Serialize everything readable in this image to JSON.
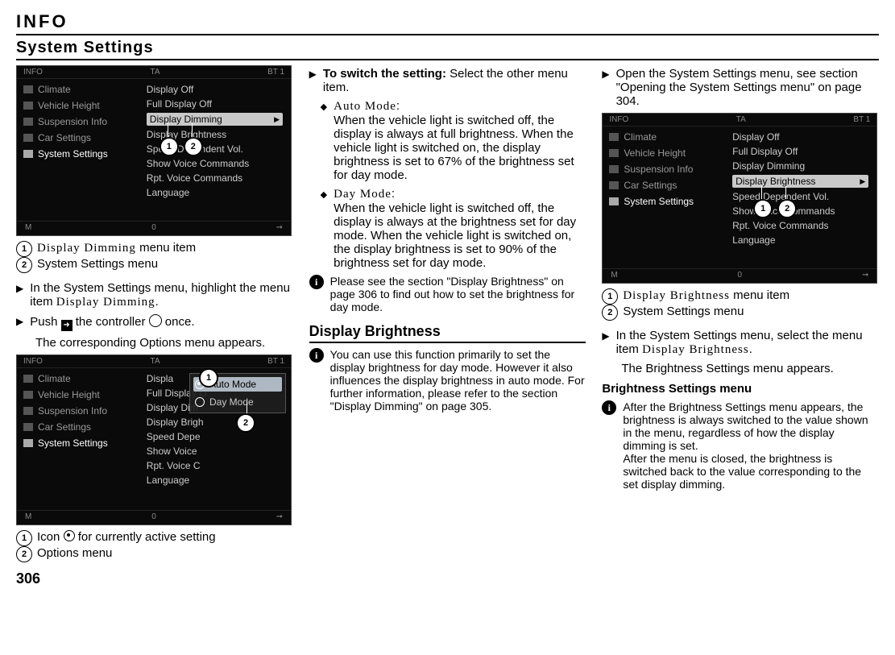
{
  "header": {
    "info": "INFO",
    "section": "System Settings"
  },
  "pageNumber": "306",
  "screenshot_common": {
    "top_left": "INFO",
    "top_mid": "TA",
    "top_right": "BT 1",
    "bottom_left": "M",
    "bottom_mid": "0",
    "bottom_right": "➞",
    "nav": {
      "climate": "Climate",
      "vehicleHeight": "Vehicle Height",
      "suspension": "Suspension Info",
      "carSettings": "Car Settings",
      "systemSettings": "System Settings"
    },
    "menu": {
      "displayOff": "Display Off",
      "fullDisplayOff": "Full Display Off",
      "displayDimming": "Display Dimming",
      "displayBrightness": "Display Brightness",
      "speedVol": "Speed Dependent Vol.",
      "showVoice": "Show Voice Commands",
      "rptVoice": "Rpt. Voice Commands",
      "language": "Language"
    }
  },
  "scrA_caption": {
    "l1_item": "Display Dimming",
    "l1_tail": " menu item",
    "l2": "System Settings menu"
  },
  "scrA_steps": {
    "s1a": "In the System Settings menu, highlight the menu item ",
    "s1b": "Display Dimming",
    "s1c": ".",
    "s2a": "Push ",
    "s2b": " the controller ",
    "s2c": " once.",
    "s2_follow": "The corresponding Options menu appears."
  },
  "popup": {
    "auto": "Auto Mode",
    "day": "Day Mode"
  },
  "scrB_menu_cut": {
    "displayOff": "Displa",
    "fullDisplayOff": "Full Display O",
    "displayDimming": "Display Dim",
    "displayBrightness": "Display Brigh",
    "speedVol": "Speed Depe",
    "showVoice": "Show Voice",
    "rptVoice": "Rpt. Voice C",
    "language": "Language"
  },
  "scrB_caption": {
    "l1": "Icon ",
    "l1_tail": " for currently active setting",
    "l2": "Options menu"
  },
  "col2": {
    "step1_lead": "To switch the setting:",
    "step1_rest": " Select the other menu item.",
    "auto_label": "Auto Mode",
    "auto_text": "When the vehicle light is switched off, the display is always at full brightness. When the vehicle light is switched on, the display brightness is set to 67% of the brightness set for day mode.",
    "day_label": "Day Mode",
    "day_text": "When the vehicle light is switched off, the display is always at the brightness set for day mode. When the vehicle light is switched on, the display brightness is set to 90% of the brightness set for day mode.",
    "note1": "Please see the section \"Display Brightness\" on page 306 to find out how to set the brightness for day mode.",
    "subhead": "Display Brightness",
    "note2": "You can use this function primarily to set the display brightness for day mode. However it also influences the display brightness in auto mode. For further information, please refer to the section \"Display Dimming\" on page 305."
  },
  "col3": {
    "step1": "Open the System Settings menu, see section \"Opening the System Settings menu\" on page 304.",
    "scrC_caption_l1_item": "Display Brightness",
    "scrC_caption_l1_tail": " menu item",
    "scrC_caption_l2": "System Settings menu",
    "step2a": "In the System Settings menu, select the menu item ",
    "step2b": "Display Brightness",
    "step2c": ".",
    "step2_follow": "The Brightness Settings menu appears.",
    "subhead": "Brightness Settings menu",
    "note": "After the Brightness Settings menu appears, the brightness is always switched to the value shown in the menu, regardless of how the display dimming is set.\nAfter the menu is closed, the brightness is switched back to the value corresponding to the set display dimming."
  }
}
